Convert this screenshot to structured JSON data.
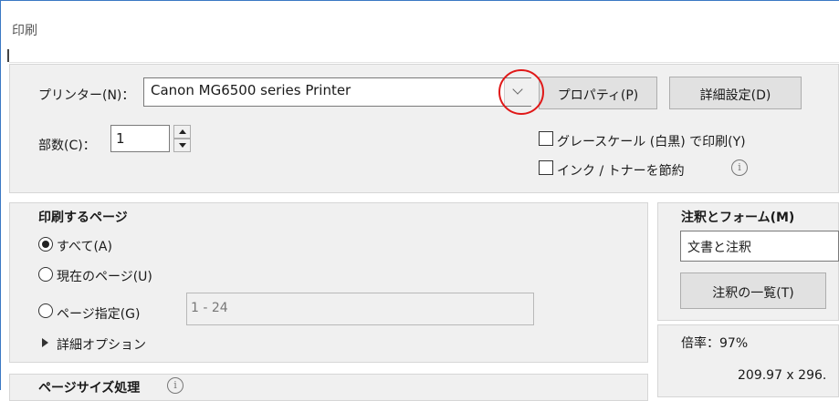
{
  "window": {
    "title": "印刷"
  },
  "printer": {
    "label": "プリンター(N)：",
    "selected": "Canon MG6500 series Printer",
    "properties_button": "プロパティ(P)",
    "advanced_button": "詳細設定(D)"
  },
  "copies": {
    "label": "部数(C)：",
    "value": "1"
  },
  "options": {
    "grayscale_label": "グレースケール (白黒) で印刷(Y)",
    "grayscale_checked": false,
    "save_ink_label": "インク / トナーを節約",
    "save_ink_checked": false,
    "info_glyph": "i"
  },
  "pages_to_print": {
    "heading": "印刷するページ",
    "all_label": "すべて(A)",
    "current_label": "現在のページ(U)",
    "range_label": "ページ指定(G)",
    "range_value": "1 - 24",
    "selected": "all",
    "more_options": "詳細オプション"
  },
  "comments_forms": {
    "heading": "注釈とフォーム(M)",
    "selected": "文書と注釈",
    "summarize_button": "注釈の一覧(T)"
  },
  "scale": {
    "label": "倍率：97%",
    "size_text": "209.97 x 296."
  },
  "page_sizing": {
    "heading": "ページサイズ処理"
  },
  "icons": {
    "dropdown": "chevron-down-icon",
    "spin_up": "triangle-up-icon",
    "spin_down": "triangle-down-icon",
    "info": "info-icon",
    "expand": "triangle-right-icon"
  },
  "colors": {
    "highlight": "#e01818",
    "panel_bg": "#f0f0f0",
    "window_border": "#3b78c4"
  }
}
